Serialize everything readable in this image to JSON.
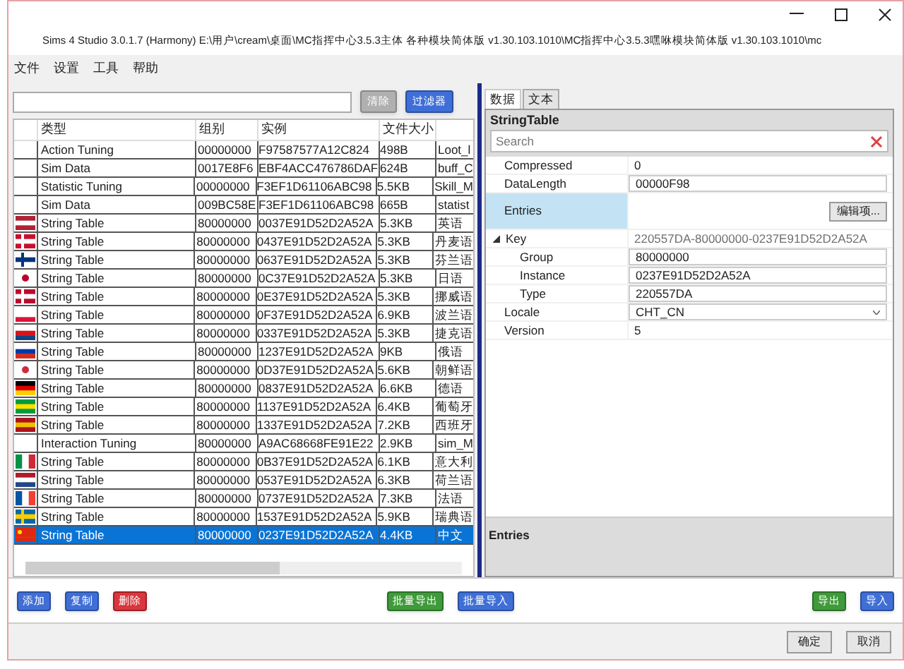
{
  "window": {
    "title": "Sims 4 Studio 3.0.1.7 (Harmony)  E:\\用户\\cream\\桌面\\MC指挥中心3.5.3主体 各种模块简体版 v1.30.103.1010\\MC指挥中心3.5.3嘿咻模块简体版 v1.30.103.1010\\mc"
  },
  "menu": [
    "文件",
    "设置",
    "工具",
    "帮助"
  ],
  "filter": {
    "buttons": [
      {
        "label": "清除",
        "kind": "gray"
      },
      {
        "label": "过滤器",
        "kind": "blue"
      }
    ]
  },
  "table": {
    "columns": [
      "类型",
      "组别",
      "实例",
      "文件大小"
    ],
    "rows": [
      {
        "kind": "plain",
        "type": "Action Tuning",
        "group": "00000000",
        "instance": "F97587577A12C824",
        "size": "498B",
        "column_5": "Loot_l",
        "selected": false
      },
      {
        "kind": "plain",
        "type": "Sim Data",
        "group": "0017E8F6",
        "instance": "EBF4ACC476786DAF",
        "size": "624B",
        "column_5": "buff_C",
        "selected": false
      },
      {
        "kind": "plain",
        "type": "Statistic Tuning",
        "group": "00000000",
        "instance": "F3EF1D61106ABC98",
        "size": "5.5KB",
        "column_5": "Skill_M",
        "selected": false
      },
      {
        "kind": "plain",
        "type": "Sim Data",
        "group": "009BC58E",
        "instance": "F3EF1D61106ABC98",
        "size": "665B",
        "column_5": "statist",
        "selected": false
      },
      {
        "kind": "us",
        "type": "String Table",
        "group": "80000000",
        "instance": "0037E91D52D2A52A",
        "size": "5.3KB",
        "column_5": "英语",
        "selected": false
      },
      {
        "kind": "dk",
        "type": "String Table",
        "group": "80000000",
        "instance": "0437E91D52D2A52A",
        "size": "5.3KB",
        "column_5": "丹麦语",
        "selected": false
      },
      {
        "kind": "fi",
        "type": "String Table",
        "group": "80000000",
        "instance": "0637E91D52D2A52A",
        "size": "5.3KB",
        "column_5": "芬兰语",
        "selected": false
      },
      {
        "kind": "jp",
        "type": "String Table",
        "group": "80000000",
        "instance": "0C37E91D52D2A52A",
        "size": "5.3KB",
        "column_5": "日语",
        "selected": false
      },
      {
        "kind": "no",
        "type": "String Table",
        "group": "80000000",
        "instance": "0E37E91D52D2A52A",
        "size": "5.3KB",
        "column_5": "挪威语",
        "selected": false
      },
      {
        "kind": "pl",
        "type": "String Table",
        "group": "80000000",
        "instance": "0F37E91D52D2A52A",
        "size": "6.9KB",
        "column_5": "波兰语",
        "selected": false
      },
      {
        "kind": "cz",
        "type": "String Table",
        "group": "80000000",
        "instance": "0337E91D52D2A52A",
        "size": "5.3KB",
        "column_5": "捷克语",
        "selected": false
      },
      {
        "kind": "ru",
        "type": "String Table",
        "group": "80000000",
        "instance": "1237E91D52D2A52A",
        "size": "9KB",
        "column_5": "俄语",
        "selected": false
      },
      {
        "kind": "kr",
        "type": "String Table",
        "group": "80000000",
        "instance": "0D37E91D52D2A52A",
        "size": "5.6KB",
        "column_5": "朝鲜语",
        "selected": false
      },
      {
        "kind": "de",
        "type": "String Table",
        "group": "80000000",
        "instance": "0837E91D52D2A52A",
        "size": "6.6KB",
        "column_5": "德语",
        "selected": false
      },
      {
        "kind": "br",
        "type": "String Table",
        "group": "80000000",
        "instance": "1137E91D52D2A52A",
        "size": "6.4KB",
        "column_5": "葡萄牙",
        "selected": false
      },
      {
        "kind": "es",
        "type": "String Table",
        "group": "80000000",
        "instance": "1337E91D52D2A52A",
        "size": "7.2KB",
        "column_5": "西班牙",
        "selected": false
      },
      {
        "kind": "plain",
        "type": "Interaction Tuning",
        "group": "80000000",
        "instance": "A9AC68668FE91E22",
        "size": "2.9KB",
        "column_5": "sim_M",
        "selected": false
      },
      {
        "kind": "it",
        "type": "String Table",
        "group": "80000000",
        "instance": "0B37E91D52D2A52A",
        "size": "6.1KB",
        "column_5": "意大利",
        "selected": false
      },
      {
        "kind": "nl",
        "type": "String Table",
        "group": "80000000",
        "instance": "0537E91D52D2A52A",
        "size": "6.3KB",
        "column_5": "荷兰语",
        "selected": false
      },
      {
        "kind": "fr",
        "type": "String Table",
        "group": "80000000",
        "instance": "0737E91D52D2A52A",
        "size": "7.3KB",
        "column_5": "法语",
        "selected": false
      },
      {
        "kind": "se",
        "type": "String Table",
        "group": "80000000",
        "instance": "1537E91D52D2A52A",
        "size": "5.9KB",
        "column_5": "瑞典语",
        "selected": false
      },
      {
        "kind": "cn",
        "type": "String Table",
        "group": "80000000",
        "instance": "0237E91D52D2A52A",
        "size": "4.4KB",
        "column_5": "中文",
        "selected": true
      }
    ]
  },
  "tabs": [
    {
      "label": "数据",
      "selected": true
    },
    {
      "label": "文本",
      "selected": false
    }
  ],
  "property_grid": {
    "title": "StringTable",
    "search": {
      "placeholder": "Search"
    },
    "properties": [
      {
        "kind": "text",
        "name": "Compressed",
        "value": "0"
      },
      {
        "kind": "field",
        "name": "DataLength",
        "value": "00000F98"
      },
      {
        "kind": "button",
        "name": "Entries",
        "button": "编辑项...",
        "selected": true
      },
      {
        "kind": "group",
        "name": "Key",
        "value": "220557DA-80000000-0237E91D52D2A52A",
        "expanded": true,
        "children": [
          {
            "kind": "field",
            "name": "Group",
            "value": "80000000"
          },
          {
            "kind": "field",
            "name": "Instance",
            "value": "0237E91D52D2A52A"
          },
          {
            "kind": "field",
            "name": "Type",
            "value": "220557DA"
          }
        ]
      },
      {
        "kind": "dropdown",
        "name": "Locale",
        "value": "CHT_CN"
      },
      {
        "kind": "text",
        "name": "Version",
        "value": "5"
      }
    ],
    "description": "Entries"
  },
  "action_buttons": [
    {
      "label": "添加",
      "kind": "blue"
    },
    {
      "label": "复制",
      "kind": "blue"
    },
    {
      "label": "删除",
      "kind": "red"
    },
    {
      "label": "批量导出",
      "kind": "green"
    },
    {
      "label": "批量导入",
      "kind": "blue"
    },
    {
      "label": "导出",
      "kind": "green"
    },
    {
      "label": "导入",
      "kind": "blue"
    }
  ],
  "dialog_buttons": [
    "确定",
    "取消"
  ]
}
